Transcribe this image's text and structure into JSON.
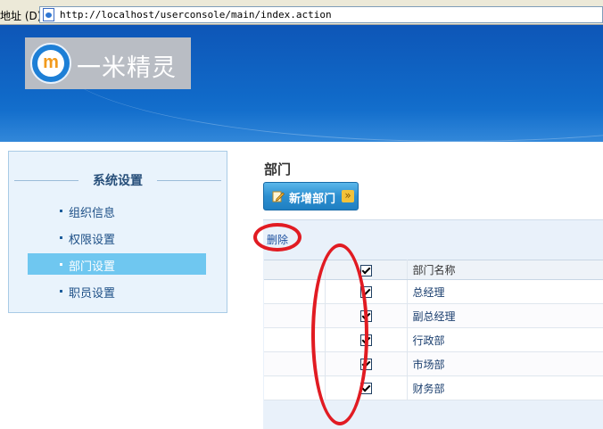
{
  "browser": {
    "address_label": "地址 (D)",
    "url": "http://localhost/userconsole/main/index.action"
  },
  "header": {
    "logo_text": "一米精灵",
    "logo_mark": "m"
  },
  "sidebar": {
    "title": "系统设置",
    "items": [
      {
        "label": "组织信息",
        "active": false
      },
      {
        "label": "权限设置",
        "active": false
      },
      {
        "label": "部门设置",
        "active": true
      },
      {
        "label": "职员设置",
        "active": false
      }
    ]
  },
  "main": {
    "title": "部门",
    "add_button_label": "新增部门",
    "delete_label": "删除",
    "table": {
      "header": {
        "name": "部门名称",
        "checked": true
      },
      "rows": [
        {
          "name": "总经理",
          "checked": true
        },
        {
          "name": "副总经理",
          "checked": true
        },
        {
          "name": "行政部",
          "checked": true
        },
        {
          "name": "市场部",
          "checked": true
        },
        {
          "name": "财务部",
          "checked": true
        }
      ]
    }
  },
  "colors": {
    "banner": "#1069c8",
    "sidebar_active": "#6fc7f0",
    "annotation": "#e11b22"
  },
  "icons": {
    "page": "page-icon",
    "add": "pencil-icon",
    "dropdown": "chevron-down-icon"
  }
}
